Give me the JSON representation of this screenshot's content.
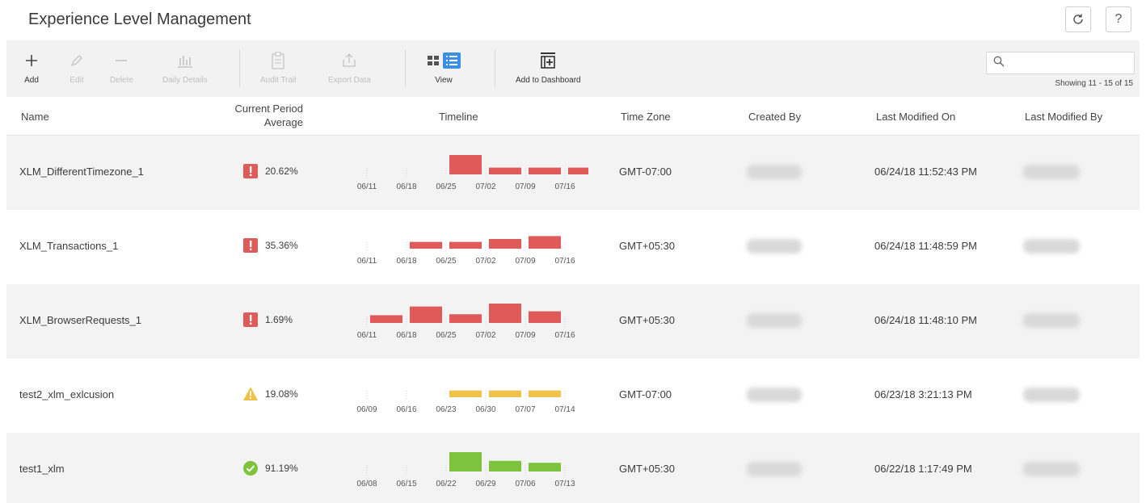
{
  "app": {
    "title": "Experience Level Management"
  },
  "titlebar": {
    "refresh_icon": "refresh-icon",
    "help_label": "?"
  },
  "toolbar": {
    "add": "Add",
    "edit": "Edit",
    "delete": "Delete",
    "daily_details": "Daily Details",
    "audit_trail": "Audit Trail",
    "export_data": "Export Data",
    "view": "View",
    "add_to_dashboard": "Add to Dashboard"
  },
  "search": {
    "placeholder": "",
    "value": ""
  },
  "pagination": {
    "showing": "Showing 11 - 15 of 15"
  },
  "columns": {
    "name": "Name",
    "avg_line1": "Current Period",
    "avg_line2": "Average",
    "timeline": "Timeline",
    "timezone": "Time Zone",
    "created_by": "Created By",
    "last_modified_on": "Last Modified On",
    "last_modified_by": "Last Modified By"
  },
  "colors": {
    "critical": "#e05a5a",
    "warning": "#f0c24a",
    "ok": "#7dc33c",
    "accent": "#3a8ee6"
  },
  "rows": [
    {
      "name": "XLM_DifferentTimezone_1",
      "status": "critical",
      "average": "20.62%",
      "dates": [
        "06/11",
        "06/18",
        "06/25",
        "07/02",
        "07/09",
        "07/16"
      ],
      "bars": [
        null,
        null,
        1.0,
        0.35,
        0.35,
        0.35
      ],
      "timezone": "GMT-07:00",
      "last_modified_on": "06/24/18 11:52:43 PM"
    },
    {
      "name": "XLM_Transactions_1",
      "status": "critical",
      "average": "35.36%",
      "dates": [
        "06/11",
        "06/18",
        "06/25",
        "07/02",
        "07/09",
        "07/16"
      ],
      "bars": [
        null,
        0.35,
        0.35,
        0.5,
        0.65,
        null
      ],
      "timezone": "GMT+05:30",
      "last_modified_on": "06/24/18 11:48:59 PM"
    },
    {
      "name": "XLM_BrowserRequests_1",
      "status": "critical",
      "average": "1.69%",
      "dates": [
        "06/11",
        "06/18",
        "06/25",
        "07/02",
        "07/09",
        "07/16"
      ],
      "bars": [
        0.4,
        0.85,
        0.45,
        1.0,
        0.6,
        null
      ],
      "timezone": "GMT+05:30",
      "last_modified_on": "06/24/18 11:48:10 PM"
    },
    {
      "name": "test2_xlm_exlcusion",
      "status": "warning",
      "average": "19.08%",
      "dates": [
        "06/09",
        "06/16",
        "06/23",
        "06/30",
        "07/07",
        "07/14"
      ],
      "bars": [
        null,
        null,
        0.35,
        0.35,
        0.35,
        null
      ],
      "timezone": "GMT-07:00",
      "last_modified_on": "06/23/18 3:21:13 PM"
    },
    {
      "name": "test1_xlm",
      "status": "ok",
      "average": "91.19%",
      "dates": [
        "06/08",
        "06/15",
        "06/22",
        "06/29",
        "07/06",
        "07/13"
      ],
      "bars": [
        null,
        null,
        1.0,
        0.55,
        0.45,
        null
      ],
      "timezone": "GMT+05:30",
      "last_modified_on": "06/22/18 1:17:49 PM"
    }
  ]
}
